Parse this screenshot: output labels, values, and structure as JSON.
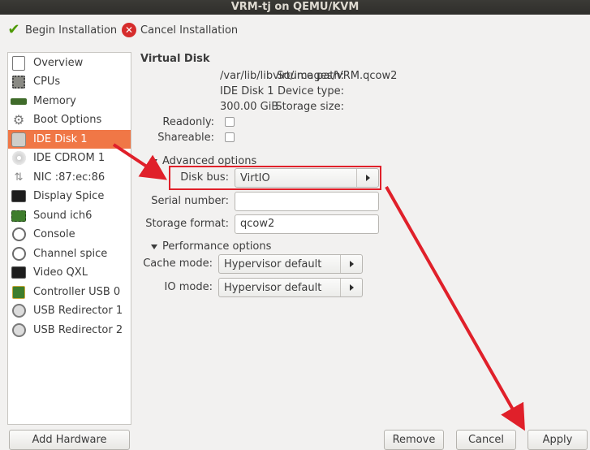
{
  "window": {
    "title": "VRM-tj on QEMU/KVM"
  },
  "toolbar": {
    "begin_label": "Begin Installation",
    "cancel_label": "Cancel Installation"
  },
  "sidebar": {
    "items": [
      {
        "label": "Overview",
        "icon": "overview-icon"
      },
      {
        "label": "CPUs",
        "icon": "cpu-icon"
      },
      {
        "label": "Memory",
        "icon": "memory-icon"
      },
      {
        "label": "Boot Options",
        "icon": "boot-options-icon"
      },
      {
        "label": "IDE Disk 1",
        "icon": "disk-icon",
        "selected": true
      },
      {
        "label": "IDE CDROM 1",
        "icon": "cdrom-icon"
      },
      {
        "label": "NIC :87:ec:86",
        "icon": "network-icon"
      },
      {
        "label": "Display Spice",
        "icon": "display-icon"
      },
      {
        "label": "Sound ich6",
        "icon": "sound-icon"
      },
      {
        "label": "Console",
        "icon": "console-icon"
      },
      {
        "label": "Channel spice",
        "icon": "channel-icon"
      },
      {
        "label": "Video QXL",
        "icon": "video-icon"
      },
      {
        "label": "Controller USB 0",
        "icon": "controller-icon"
      },
      {
        "label": "USB Redirector 1",
        "icon": "usb-icon"
      },
      {
        "label": "USB Redirector 2",
        "icon": "usb-icon"
      }
    ],
    "add_hardware_label": "Add Hardware"
  },
  "disk": {
    "section_title": "Virtual Disk",
    "source_path_label": "Source path:",
    "source_path": "/var/lib/libvirt/images/VRM.qcow2",
    "device_type_label": "Device type:",
    "device_type": "IDE Disk 1",
    "storage_size_label": "Storage size:",
    "storage_size": "300.00 GiB",
    "readonly_label": "Readonly:",
    "shareable_label": "Shareable:",
    "advanced_label": "Advanced options",
    "disk_bus_label": "Disk bus:",
    "disk_bus_value": "VirtIO",
    "serial_label": "Serial number:",
    "serial_value": "",
    "storage_format_label": "Storage format:",
    "storage_format_value": "qcow2",
    "performance_label": "Performance options",
    "cache_mode_label": "Cache mode:",
    "cache_mode_value": "Hypervisor default",
    "io_mode_label": "IO mode:",
    "io_mode_value": "Hypervisor default"
  },
  "footer": {
    "remove_label": "Remove",
    "cancel_label": "Cancel",
    "apply_label": "Apply"
  },
  "colors": {
    "selection": "#f07746",
    "annotation": "#e0202a",
    "titlebar": "#33322f"
  }
}
